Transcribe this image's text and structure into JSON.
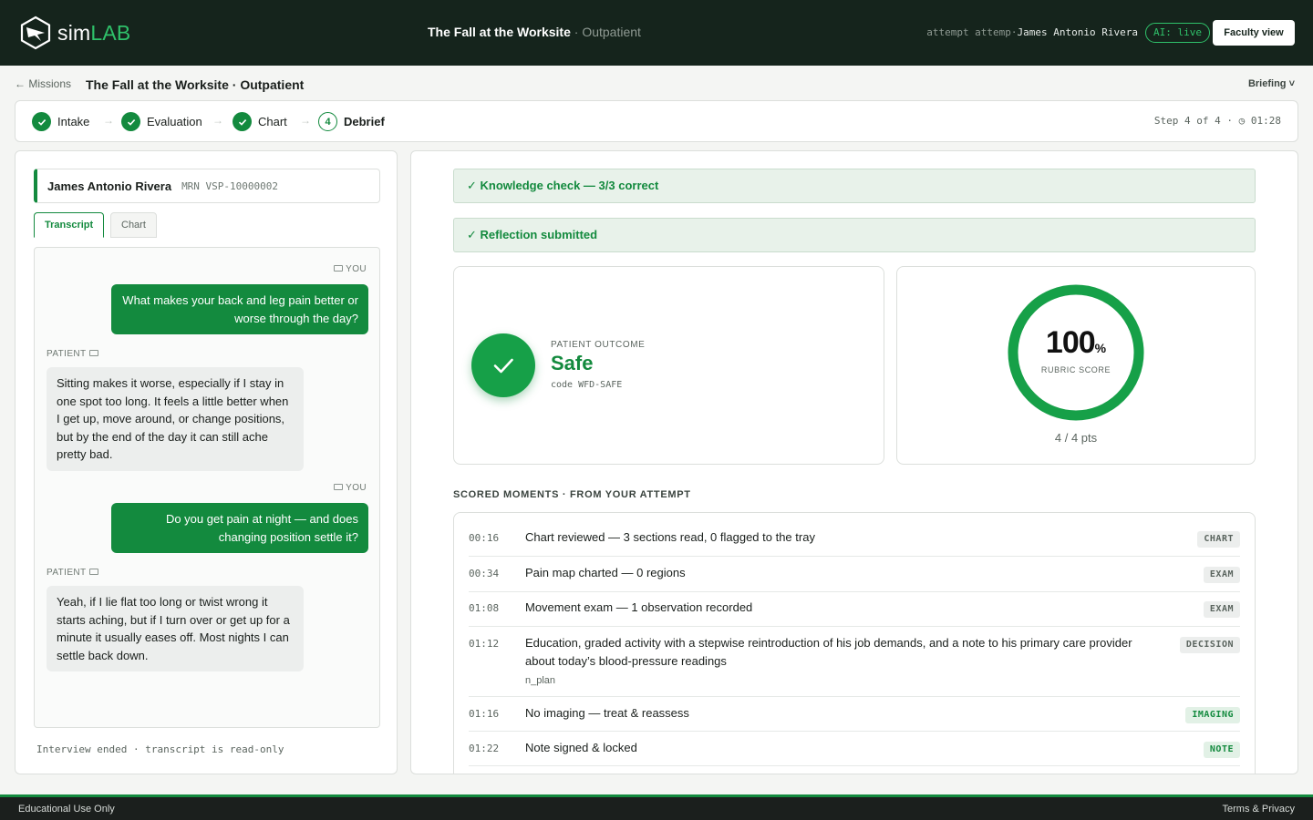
{
  "brand": {
    "name_a": "sim",
    "name_b": "LAB"
  },
  "header": {
    "title": "The Fall at the Worksite",
    "subtitle": "· Outpatient",
    "attempt_prefix": "attempt attemp·",
    "attempt_name": "James Antonio Rivera",
    "ai_status": "AI: live",
    "faculty_button": "Faculty view"
  },
  "subheader": {
    "back_link": "← Missions",
    "title": "The Fall at the Worksite · Outpatient",
    "briefing": "Briefing ˅"
  },
  "stepper": {
    "steps": [
      {
        "label": "Intake",
        "state": "done"
      },
      {
        "label": "Evaluation",
        "state": "done"
      },
      {
        "label": "Chart",
        "state": "done"
      },
      {
        "label": "Debrief",
        "state": "current",
        "number": "4"
      }
    ],
    "meta": "Step 4 of 4 · ◷ 01:28"
  },
  "patient": {
    "name": "James Antonio Rivera",
    "mrn": "MRN VSP-10000002"
  },
  "tabs": {
    "transcript": "Transcript",
    "chart": "Chart"
  },
  "transcript": {
    "you_label": "YOU",
    "patient_label": "PATIENT",
    "messages": [
      "What makes your back and leg pain better or worse through the day?",
      "Sitting makes it worse, especially if I stay in one spot too long. It feels a little better when I get up, move around, or change positions, but by the end of the day it can still ache pretty bad.",
      "Do you get pain at night — and does changing position settle it?",
      "Yeah, if I lie flat too long or twist wrong it starts aching, but if I turn over or get up for a minute it usually eases off. Most nights I can settle back down."
    ],
    "status": "Interview ended · transcript is read-only"
  },
  "debrief": {
    "knowledge_check": "✓ Knowledge check — 3/3 correct",
    "reflection": "✓ Reflection submitted",
    "outcome_label": "PATIENT OUTCOME",
    "outcome_value": "Safe",
    "outcome_code": "code WFD-SAFE",
    "score_value": "100",
    "score_unit": "%",
    "score_fraction": 1.0,
    "score_label": "RUBRIC SCORE",
    "points": "4 / 4 pts",
    "section_title": "SCORED MOMENTS · FROM YOUR ATTEMPT",
    "moments": [
      {
        "time": "00:16",
        "desc": "Chart reviewed — 3 sections read, 0 flagged to the tray",
        "sub": "",
        "tag": "CHART"
      },
      {
        "time": "00:34",
        "desc": "Pain map charted — 0 regions",
        "sub": "",
        "tag": "EXAM"
      },
      {
        "time": "01:08",
        "desc": "Movement exam — 1 observation recorded",
        "sub": "",
        "tag": "EXAM"
      },
      {
        "time": "01:12",
        "desc": "Education, graded activity with a stepwise reintroduction of his job demands, and a note to his primary care provider about today’s blood-pressure readings",
        "sub": "n_plan",
        "tag": "DECISION"
      },
      {
        "time": "01:16",
        "desc": "No imaging — treat & reassess",
        "sub": "",
        "tag": "IMAGING"
      },
      {
        "time": "01:22",
        "desc": "Note signed & locked",
        "sub": "",
        "tag": "NOTE"
      }
    ]
  },
  "footer": {
    "left": "Educational Use Only",
    "right": "Terms & Privacy"
  },
  "colors": {
    "brand_green": "#138a3e",
    "topbar": "#15241c",
    "accent_light": "#2fc16a"
  }
}
